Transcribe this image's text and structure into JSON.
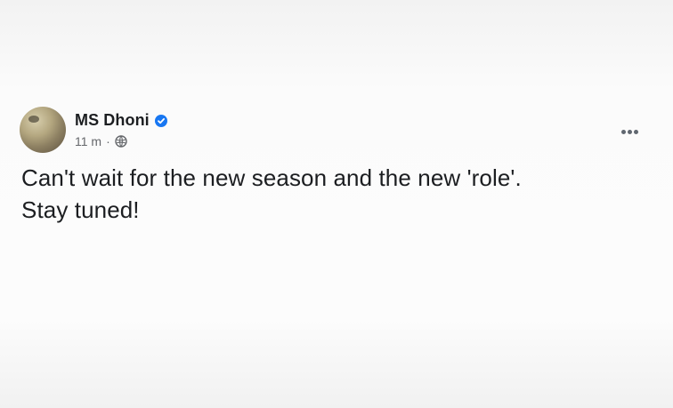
{
  "post": {
    "author": {
      "name": "MS Dhoni",
      "verified": true,
      "avatar": "profile-photo"
    },
    "time": "11 m",
    "separator": "·",
    "privacy_icon": "globe-icon",
    "more_icon": "more-options-icon",
    "text_line_1": "Can't wait for the new season and the new 'role'.",
    "text_line_2": "Stay tuned!"
  },
  "colors": {
    "text_primary": "#1c1e21",
    "text_secondary": "#65676b",
    "verified_blue": "#1877f2",
    "background": "#fbfbfb"
  }
}
